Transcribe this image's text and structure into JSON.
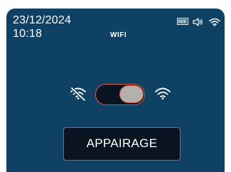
{
  "header": {
    "date": "23/12/2024",
    "time": "10:18",
    "title": "WIFI"
  },
  "status_icons": [
    "battery-icon",
    "volume-icon",
    "wifi-icon"
  ],
  "wifi_toggle": {
    "off_icon": "wifi-off-icon",
    "on_icon": "wifi-on-icon",
    "state": "on"
  },
  "pair_button": {
    "label": "APPAIRAGE"
  },
  "colors": {
    "background": "#0e4163",
    "accent": "#d75a45",
    "button_fill": "#0a1420",
    "knob": "#b3b0ae",
    "text": "#ffffff"
  }
}
